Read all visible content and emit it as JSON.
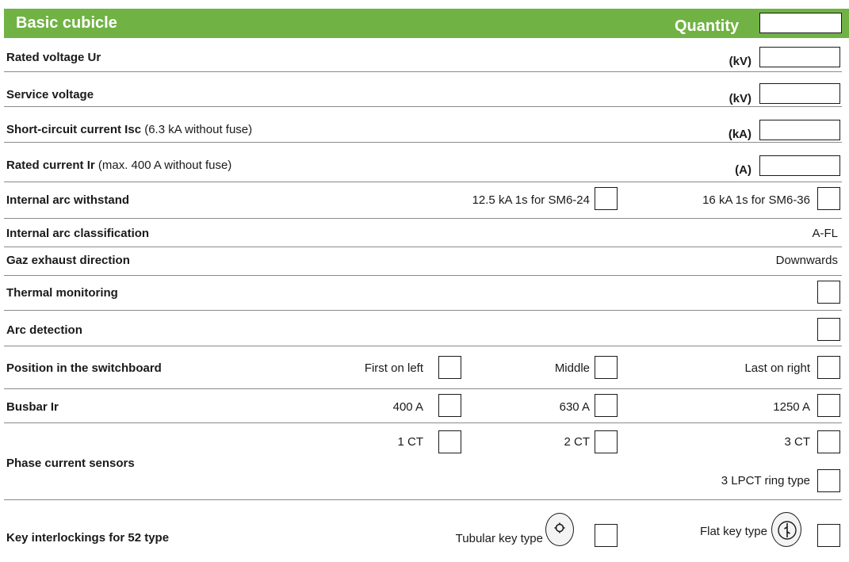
{
  "header": {
    "title": "Basic cubicle",
    "quantity_label": "Quantity"
  },
  "rows": {
    "rated_voltage": {
      "label": "Rated voltage Ur",
      "unit": "(kV)"
    },
    "service_voltage": {
      "label": "Service voltage",
      "unit": "(kV)"
    },
    "short_circuit": {
      "label": "Short-circuit current Isc",
      "note": "(6.3 kA without fuse)",
      "unit": "(kA)"
    },
    "rated_current": {
      "label": "Rated current Ir",
      "note": "(max. 400 A without fuse)",
      "unit": "(A)"
    },
    "internal_arc": {
      "label": "Internal arc withstand",
      "options": [
        "12.5 kA 1s for SM6-24",
        "16 kA 1s for SM6-36"
      ]
    },
    "arc_classification": {
      "label": "Internal arc classification",
      "value": "A-FL"
    },
    "gaz_exhaust": {
      "label": "Gaz exhaust direction",
      "value": "Downwards"
    },
    "thermal_monitoring": {
      "label": "Thermal monitoring"
    },
    "arc_detection": {
      "label": "Arc detection"
    },
    "position": {
      "label": "Position in the switchboard",
      "options": [
        "First on left",
        "Middle",
        "Last on right"
      ]
    },
    "busbar": {
      "label": "Busbar Ir",
      "options": [
        "400 A",
        "630 A",
        "1250 A"
      ]
    },
    "phase_sensors": {
      "label": "Phase current sensors",
      "options": [
        "1 CT",
        "2 CT",
        "3 CT",
        "3 LPCT ring type"
      ]
    },
    "key_interlock": {
      "label": "Key interlockings for 52 type",
      "options": [
        "Tubular key type",
        "Flat key type"
      ]
    }
  }
}
